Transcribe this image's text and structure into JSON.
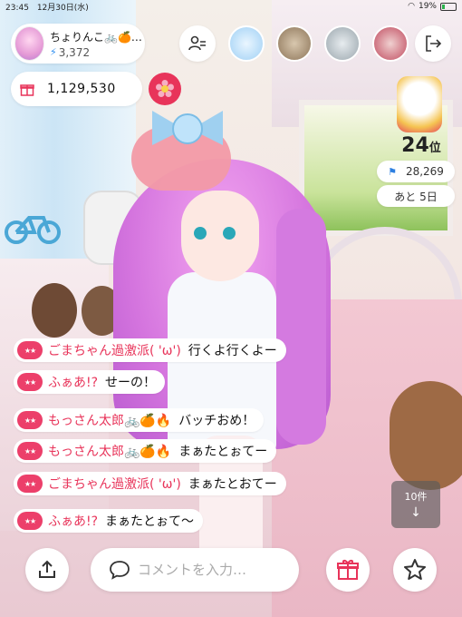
{
  "status_bar": {
    "time": "23:45",
    "date": "12月30日(水)",
    "battery": "19%"
  },
  "host": {
    "name": "ちょりんこ🚲🍊…",
    "points": "3,372"
  },
  "gift_total": {
    "amount": "1,129,530"
  },
  "ranking": {
    "rank": "24",
    "unit": "位",
    "score": "28,269",
    "remaining": "あと 5日"
  },
  "comments": [
    {
      "user": "ごまちゃん過激派( 'ω')",
      "message": "行くよ行くよー"
    },
    {
      "user": "ふぁあ!?",
      "message": "せーの！"
    },
    {
      "user": "もっさん太郎🚲🍊🔥",
      "message": "バッチおめ！"
    },
    {
      "user": "もっさん太郎🚲🍊🔥",
      "message": "まぁたとぉてー"
    },
    {
      "user": "ごまちゃん過激派( 'ω')",
      "message": "まぁたとおてー"
    },
    {
      "user": "ふぁあ!?",
      "message": "まぁたとぉて〜"
    }
  ],
  "new_comments": {
    "label": "10件",
    "arrow": "↓"
  },
  "comment_input": {
    "placeholder": "コメントを入力…"
  },
  "icons": [
    "bolt-icon",
    "follow-list-icon",
    "exit-icon",
    "gift-icon",
    "flower-icon",
    "flag-icon",
    "share-icon",
    "speech-bubble-icon",
    "star-icon"
  ],
  "colors": {
    "accent": "#e8345a",
    "badge": "#ec3f6a",
    "bolt": "#2d8ef0"
  }
}
